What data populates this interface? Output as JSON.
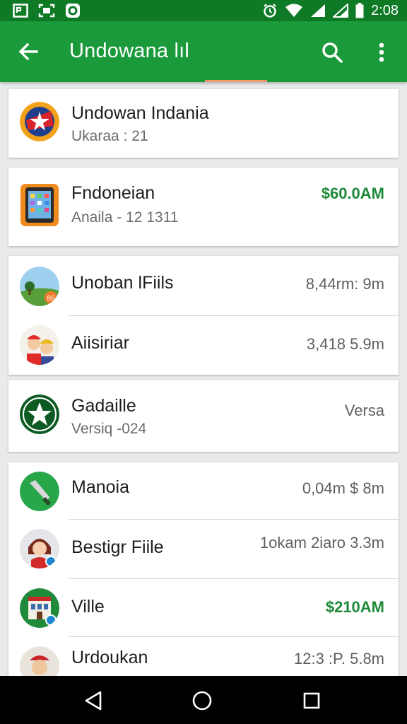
{
  "status_bar": {
    "time": "2:08",
    "left_icons": [
      "image-icon",
      "screenshot-icon",
      "app-badge-icon"
    ],
    "right_icons": [
      "alarm-icon",
      "wifi-icon",
      "signal-icon",
      "signal-icon-2",
      "battery-icon"
    ]
  },
  "app_bar": {
    "title": "Undowana  lıl",
    "colors": {
      "background": "#1a9a3a",
      "status": "#0e7a26",
      "accent_line": "#f29a70"
    }
  },
  "cards": [
    {
      "rows": [
        {
          "name": "Undowan Indania",
          "subtitle": "Ukaraa : 21",
          "value": ""
        }
      ]
    },
    {
      "rows": [
        {
          "name": "Fndoneian",
          "subtitle": "Anaila - 12 1311",
          "value": "$60.0AM",
          "value_green": true
        }
      ]
    },
    {
      "rows": [
        {
          "name": "Unoban lFiils",
          "subtitle": "",
          "value": "8,44rm: 9m"
        },
        {
          "name": "Aiisiriar",
          "subtitle": "",
          "value": "3,418 5.9m"
        }
      ]
    },
    {
      "rows": [
        {
          "name": "Gadaille",
          "subtitle": "Versiq -024",
          "value": "Versa"
        }
      ]
    },
    {
      "rows": [
        {
          "name": "Manoia",
          "subtitle": "",
          "value": "0,04m $ 8m"
        },
        {
          "name": "Bestigr Fiile",
          "subtitle": "",
          "value": "1okam 2iaro 3.3m"
        },
        {
          "name": "Ville",
          "subtitle": "",
          "value": "$210AM",
          "value_green": true
        },
        {
          "name": "Urdoukan",
          "subtitle": "",
          "value": "12:3 :P. 5.8m"
        }
      ]
    }
  ],
  "nav_bar": {
    "icons": [
      "back-triangle-icon",
      "home-circle-icon",
      "recents-square-icon"
    ]
  }
}
